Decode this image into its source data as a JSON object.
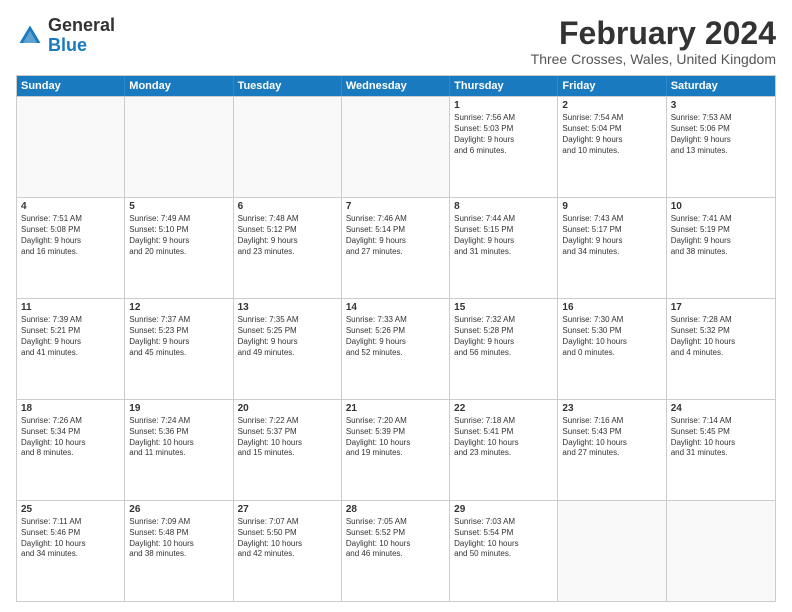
{
  "header": {
    "logo_general": "General",
    "logo_blue": "Blue",
    "title": "February 2024",
    "location": "Three Crosses, Wales, United Kingdom"
  },
  "days": [
    "Sunday",
    "Monday",
    "Tuesday",
    "Wednesday",
    "Thursday",
    "Friday",
    "Saturday"
  ],
  "weeks": [
    [
      {
        "day": "",
        "info": ""
      },
      {
        "day": "",
        "info": ""
      },
      {
        "day": "",
        "info": ""
      },
      {
        "day": "",
        "info": ""
      },
      {
        "day": "1",
        "info": "Sunrise: 7:56 AM\nSunset: 5:03 PM\nDaylight: 9 hours\nand 6 minutes."
      },
      {
        "day": "2",
        "info": "Sunrise: 7:54 AM\nSunset: 5:04 PM\nDaylight: 9 hours\nand 10 minutes."
      },
      {
        "day": "3",
        "info": "Sunrise: 7:53 AM\nSunset: 5:06 PM\nDaylight: 9 hours\nand 13 minutes."
      }
    ],
    [
      {
        "day": "4",
        "info": "Sunrise: 7:51 AM\nSunset: 5:08 PM\nDaylight: 9 hours\nand 16 minutes."
      },
      {
        "day": "5",
        "info": "Sunrise: 7:49 AM\nSunset: 5:10 PM\nDaylight: 9 hours\nand 20 minutes."
      },
      {
        "day": "6",
        "info": "Sunrise: 7:48 AM\nSunset: 5:12 PM\nDaylight: 9 hours\nand 23 minutes."
      },
      {
        "day": "7",
        "info": "Sunrise: 7:46 AM\nSunset: 5:14 PM\nDaylight: 9 hours\nand 27 minutes."
      },
      {
        "day": "8",
        "info": "Sunrise: 7:44 AM\nSunset: 5:15 PM\nDaylight: 9 hours\nand 31 minutes."
      },
      {
        "day": "9",
        "info": "Sunrise: 7:43 AM\nSunset: 5:17 PM\nDaylight: 9 hours\nand 34 minutes."
      },
      {
        "day": "10",
        "info": "Sunrise: 7:41 AM\nSunset: 5:19 PM\nDaylight: 9 hours\nand 38 minutes."
      }
    ],
    [
      {
        "day": "11",
        "info": "Sunrise: 7:39 AM\nSunset: 5:21 PM\nDaylight: 9 hours\nand 41 minutes."
      },
      {
        "day": "12",
        "info": "Sunrise: 7:37 AM\nSunset: 5:23 PM\nDaylight: 9 hours\nand 45 minutes."
      },
      {
        "day": "13",
        "info": "Sunrise: 7:35 AM\nSunset: 5:25 PM\nDaylight: 9 hours\nand 49 minutes."
      },
      {
        "day": "14",
        "info": "Sunrise: 7:33 AM\nSunset: 5:26 PM\nDaylight: 9 hours\nand 52 minutes."
      },
      {
        "day": "15",
        "info": "Sunrise: 7:32 AM\nSunset: 5:28 PM\nDaylight: 9 hours\nand 56 minutes."
      },
      {
        "day": "16",
        "info": "Sunrise: 7:30 AM\nSunset: 5:30 PM\nDaylight: 10 hours\nand 0 minutes."
      },
      {
        "day": "17",
        "info": "Sunrise: 7:28 AM\nSunset: 5:32 PM\nDaylight: 10 hours\nand 4 minutes."
      }
    ],
    [
      {
        "day": "18",
        "info": "Sunrise: 7:26 AM\nSunset: 5:34 PM\nDaylight: 10 hours\nand 8 minutes."
      },
      {
        "day": "19",
        "info": "Sunrise: 7:24 AM\nSunset: 5:36 PM\nDaylight: 10 hours\nand 11 minutes."
      },
      {
        "day": "20",
        "info": "Sunrise: 7:22 AM\nSunset: 5:37 PM\nDaylight: 10 hours\nand 15 minutes."
      },
      {
        "day": "21",
        "info": "Sunrise: 7:20 AM\nSunset: 5:39 PM\nDaylight: 10 hours\nand 19 minutes."
      },
      {
        "day": "22",
        "info": "Sunrise: 7:18 AM\nSunset: 5:41 PM\nDaylight: 10 hours\nand 23 minutes."
      },
      {
        "day": "23",
        "info": "Sunrise: 7:16 AM\nSunset: 5:43 PM\nDaylight: 10 hours\nand 27 minutes."
      },
      {
        "day": "24",
        "info": "Sunrise: 7:14 AM\nSunset: 5:45 PM\nDaylight: 10 hours\nand 31 minutes."
      }
    ],
    [
      {
        "day": "25",
        "info": "Sunrise: 7:11 AM\nSunset: 5:46 PM\nDaylight: 10 hours\nand 34 minutes."
      },
      {
        "day": "26",
        "info": "Sunrise: 7:09 AM\nSunset: 5:48 PM\nDaylight: 10 hours\nand 38 minutes."
      },
      {
        "day": "27",
        "info": "Sunrise: 7:07 AM\nSunset: 5:50 PM\nDaylight: 10 hours\nand 42 minutes."
      },
      {
        "day": "28",
        "info": "Sunrise: 7:05 AM\nSunset: 5:52 PM\nDaylight: 10 hours\nand 46 minutes."
      },
      {
        "day": "29",
        "info": "Sunrise: 7:03 AM\nSunset: 5:54 PM\nDaylight: 10 hours\nand 50 minutes."
      },
      {
        "day": "",
        "info": ""
      },
      {
        "day": "",
        "info": ""
      }
    ]
  ]
}
